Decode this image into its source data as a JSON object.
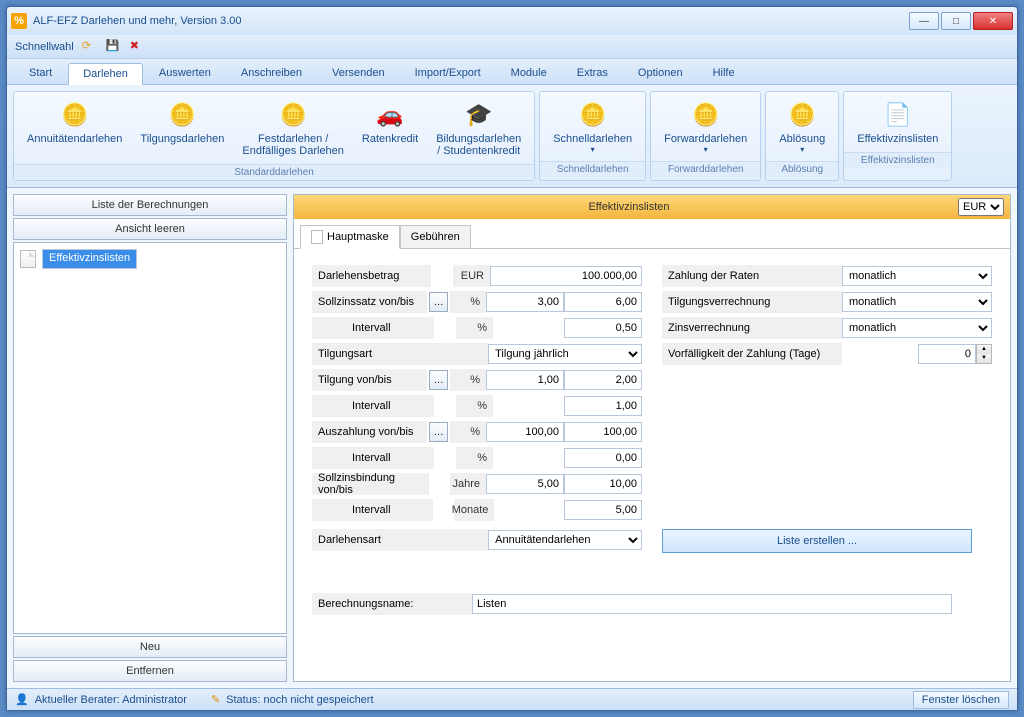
{
  "window": {
    "title": "ALF-EFZ Darlehen und mehr, Version 3.00"
  },
  "quickbar": {
    "label": "Schnellwahl"
  },
  "menu": {
    "tabs": [
      "Start",
      "Darlehen",
      "Auswerten",
      "Anschreiben",
      "Versenden",
      "Import/Export",
      "Module",
      "Extras",
      "Optionen",
      "Hilfe"
    ],
    "active": 1
  },
  "ribbon": {
    "groups": [
      {
        "caption": "Standarddarlehen",
        "items": [
          {
            "label": "Annuitätendarlehen",
            "icon": "coins"
          },
          {
            "label": "Tilgungsdarlehen",
            "icon": "coins"
          },
          {
            "label": "Festdarlehen /\nEndfälliges Darlehen",
            "icon": "coins"
          },
          {
            "label": "Ratenkredit",
            "icon": "car"
          },
          {
            "label": "Bildungsdarlehen\n/ Studentenkredit",
            "icon": "grad"
          }
        ]
      },
      {
        "caption": "Schnelldarlehen",
        "items": [
          {
            "label": "Schnelldarlehen",
            "icon": "coins-blue",
            "drop": true
          }
        ]
      },
      {
        "caption": "Forwarddarlehen",
        "items": [
          {
            "label": "Forwarddarlehen",
            "icon": "coins-fwd",
            "drop": true
          }
        ]
      },
      {
        "caption": "Ablösung",
        "items": [
          {
            "label": "Ablösung",
            "icon": "coins-red",
            "drop": true
          }
        ]
      },
      {
        "caption": "Effektivzinslisten",
        "items": [
          {
            "label": "Effektivzinslisten",
            "icon": "list"
          }
        ]
      }
    ]
  },
  "left": {
    "btn1": "Liste der Berechnungen",
    "btn2": "Ansicht leeren",
    "tree_item": "Effektivzinslisten",
    "btn_neu": "Neu",
    "btn_entfernen": "Entfernen"
  },
  "main": {
    "title": "Effektivzinslisten",
    "currency": "EUR",
    "tabs": [
      "Hauptmaske",
      "Gebühren"
    ],
    "form": {
      "darlehensbetrag_lbl": "Darlehensbetrag",
      "darlehensbetrag_unit": "EUR",
      "darlehensbetrag": "100.000,00",
      "sollzins_lbl": "Sollzinssatz von/bis",
      "pct": "%",
      "sollzins_von": "3,00",
      "sollzins_bis": "6,00",
      "intervall_lbl": "Intervall",
      "sollzins_int": "0,50",
      "tilgungsart_lbl": "Tilgungsart",
      "tilgungsart": "Tilgung jährlich",
      "tilgung_lbl": "Tilgung von/bis",
      "tilgung_von": "1,00",
      "tilgung_bis": "2,00",
      "tilgung_int": "1,00",
      "auszahlung_lbl": "Auszahlung von/bis",
      "auszahlung_von": "100,00",
      "auszahlung_bis": "100,00",
      "auszahlung_int": "0,00",
      "bindung_lbl": "Sollzinsbindung von/bis",
      "jahre": "Jahre",
      "bindung_von": "5,00",
      "bindung_bis": "10,00",
      "monate": "Monate",
      "bindung_int": "5,00",
      "darlehensart_lbl": "Darlehensart",
      "darlehensart": "Annuitätendarlehen",
      "zahlung_lbl": "Zahlung der Raten",
      "monatlich": "monatlich",
      "tilgverr_lbl": "Tilgungsverrechnung",
      "zinsverr_lbl": "Zinsverrechnung",
      "vorfall_lbl": "Vorfälligkeit der Zahlung (Tage)",
      "vorfall": "0",
      "liste_btn": "Liste erstellen ...",
      "berechname_lbl": "Berechnungsname:",
      "berechname": "Listen"
    }
  },
  "status": {
    "berater": "Aktueller Berater: Administrator",
    "status": "Status: noch nicht gespeichert",
    "fenster": "Fenster löschen"
  }
}
